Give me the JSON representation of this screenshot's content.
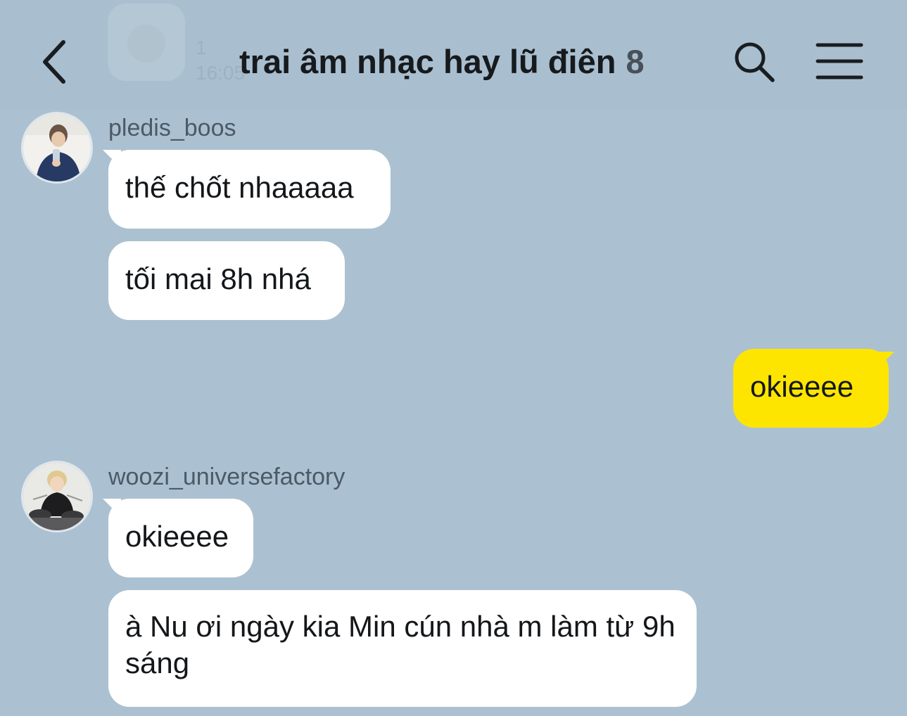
{
  "header": {
    "title": "trai âm nhạc hay lũ điên",
    "member_count": "8",
    "ghost_time": "16:05",
    "ghost_count": "1"
  },
  "icons": {
    "back": "chevron-left-icon",
    "search": "search-icon",
    "menu": "hamburger-menu-icon"
  },
  "colors": {
    "background": "#abc1d1",
    "my_bubble": "#fee500",
    "other_bubble": "#ffffff"
  },
  "messages": [
    {
      "sender": "pledis_boos",
      "text": "thế chốt nhaaaaa"
    },
    {
      "sender": "pledis_boos",
      "text": "tối mai 8h nhá"
    },
    {
      "sender": "me",
      "text": "okieeee"
    },
    {
      "sender": "woozi_universefactory",
      "text": "okieeee"
    },
    {
      "sender": "woozi_universefactory",
      "text": "à Nu ơi ngày kia Min cún nhà m làm từ 9h sáng"
    }
  ],
  "senders": [
    {
      "name": "pledis_boos"
    },
    {
      "name": "woozi_universefactory"
    }
  ]
}
